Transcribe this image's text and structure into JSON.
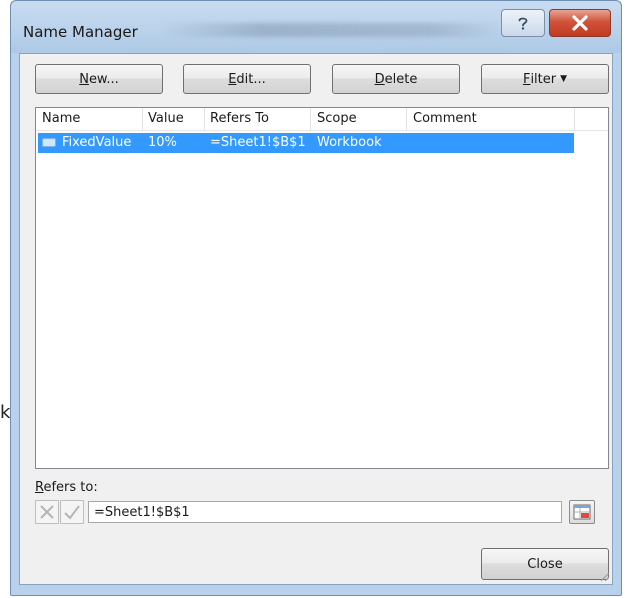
{
  "backdrop": {
    "stray_text": "k"
  },
  "dialog": {
    "title": "Name Manager",
    "help_icon": "help-icon",
    "close_icon": "close-icon"
  },
  "toolbar": {
    "new": {
      "label": "New...",
      "mnemonic": "N",
      "rest": "ew..."
    },
    "edit": {
      "label": "Edit...",
      "mnemonic": "E",
      "rest": "dit..."
    },
    "delete": {
      "label": "Delete",
      "mnemonic": "D",
      "rest": "elete"
    },
    "filter": {
      "label": "Filter",
      "mnemonic": "F",
      "rest": "ilter",
      "arrow": "▼"
    }
  },
  "names_list": {
    "columns": [
      "Name",
      "Value",
      "Refers To",
      "Scope",
      "Comment"
    ],
    "rows": [
      {
        "name": "FixedValue",
        "value": "10%",
        "refers_to": "=Sheet1!$B$1",
        "scope": "Workbook",
        "comment": "",
        "selected": true
      }
    ]
  },
  "refers_to": {
    "label": "Refers to:",
    "mnemonic": "R",
    "rest": "efers to:",
    "value": "=Sheet1!$B$1",
    "cancel_icon": "cancel-x-icon",
    "confirm_icon": "confirm-check-icon",
    "collapse_icon": "range-select-icon"
  },
  "footer": {
    "close_label": "Close"
  },
  "colors": {
    "selection": "#3399ff",
    "dialog_frame": "#b9d1ea",
    "close_button": "#c23b22"
  }
}
